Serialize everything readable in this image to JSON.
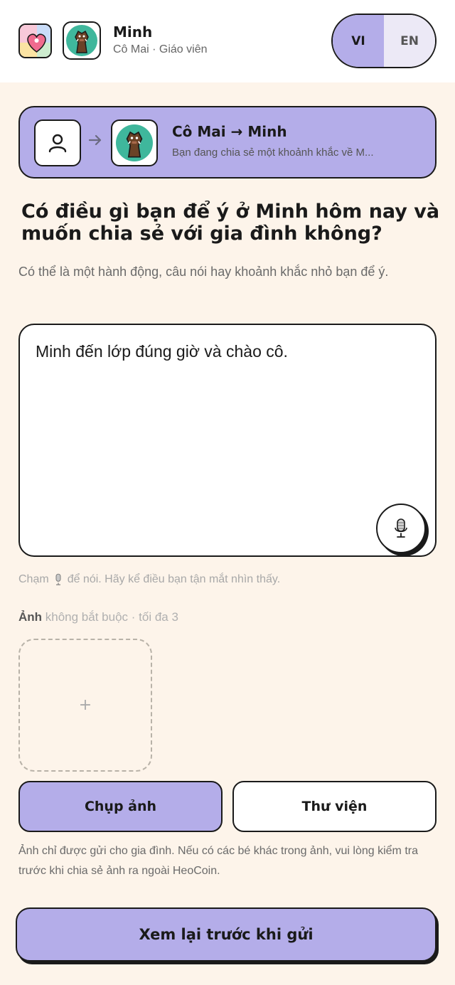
{
  "header": {
    "app_logo_icon": "heart-app-logo-icon",
    "child_avatar_icon": "boar-avatar-icon",
    "child_name": "Minh",
    "child_sub": "Cô Mai · Giáo viên",
    "lang": {
      "vi": "VI",
      "en": "EN",
      "active": "VI"
    }
  },
  "banner": {
    "teacher_icon": "person-icon",
    "arrow_icon": "arrow-right-icon",
    "title": "Cô Mai → Minh",
    "subtitle": "Bạn đang chia sẻ một khoảnh khắc về M..."
  },
  "prompt": {
    "question": "Có điều gì bạn để ý ở Minh hôm nay và muốn chia sẻ với gia đình không?",
    "helper": "Có thể là một hành động, câu nói hay khoảnh khắc nhỏ bạn để ý."
  },
  "input": {
    "value": "Minh đến lớp đúng giờ và chào cô.",
    "mic_icon": "microphone-icon"
  },
  "mic_hint": {
    "before": "Chạm",
    "after": "để nói. Hãy kể điều bạn tận mắt nhìn thấy."
  },
  "photos": {
    "label_bold": "Ảnh",
    "label_rest": " không bắt buộc · tối đa 3",
    "add_symbol": "+",
    "take_photo": "Chụp ảnh",
    "library": "Thư viện",
    "privacy": "Ảnh chỉ được gửi cho gia đình. Nếu có các bé khác trong ảnh, vui lòng kiểm tra trước khi chia sẻ ảnh ra ngoài HeoCoin."
  },
  "footer": {
    "review": "Xem lại trước khi gửi"
  },
  "colors": {
    "accent": "#b4ade9",
    "background": "#fdf4ea",
    "avatar_bg": "#3fb79c",
    "border": "#1a1a1a"
  }
}
